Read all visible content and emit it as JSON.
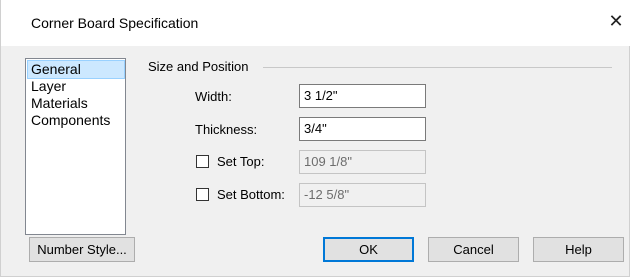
{
  "window": {
    "title": "Corner Board Specification",
    "close_glyph": "✕"
  },
  "nav": {
    "items": [
      "General",
      "Layer",
      "Materials",
      "Components"
    ],
    "selected": "General"
  },
  "size_position": {
    "group_label": "Size and Position",
    "width": {
      "label": "Width:",
      "value": "3 1/2\""
    },
    "thickness": {
      "label": "Thickness:",
      "value": "3/4\""
    },
    "set_top": {
      "label": "Set Top:",
      "checked": false,
      "value": "109 1/8\""
    },
    "set_bottom": {
      "label": "Set Bottom:",
      "checked": false,
      "value": "-12 5/8\""
    }
  },
  "buttons": {
    "number_style": "Number Style...",
    "ok": "OK",
    "cancel": "Cancel",
    "help": "Help"
  }
}
